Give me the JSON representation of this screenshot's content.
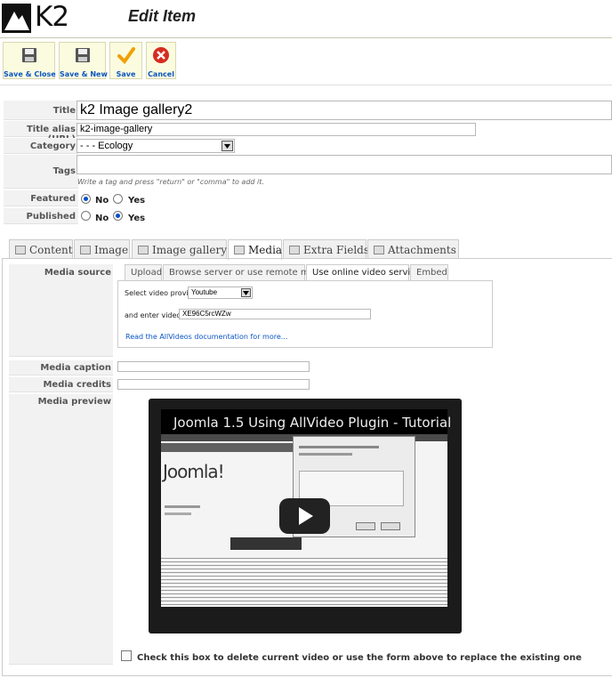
{
  "header": {
    "logo_text": "K2",
    "page_title": "Edit Item"
  },
  "toolbar": {
    "save_close": "Save & Close",
    "save_new": "Save & New",
    "save": "Save",
    "cancel": "Cancel"
  },
  "form": {
    "title_label": "Title",
    "title_value": "k2 Image gallery2",
    "alias_label": "Title alias (URL)",
    "alias_value": "k2-image-gallery",
    "category_label": "Category",
    "category_value": "- - - Ecology",
    "tags_label": "Tags",
    "tags_hint": "Write a tag and press \"return\" or \"comma\" to add it.",
    "featured_label": "Featured",
    "published_label": "Published",
    "no": "No",
    "yes": "Yes",
    "featured": "No",
    "published": "Yes"
  },
  "tabs": [
    {
      "label": "Content",
      "icon": "document-icon"
    },
    {
      "label": "Image",
      "icon": "image-icon"
    },
    {
      "label": "Image gallery",
      "icon": "gallery-icon"
    },
    {
      "label": "Media",
      "icon": "film-icon",
      "active": true
    },
    {
      "label": "Extra Fields",
      "icon": "tools-icon"
    },
    {
      "label": "Attachments",
      "icon": "paperclip-icon"
    }
  ],
  "media": {
    "source_label": "Media source",
    "subtabs": [
      "Upload",
      "Browse server or use remote media",
      "Use online video service",
      "Embed"
    ],
    "active_subtab": "Use online video service",
    "provider_label": "Select video provider",
    "provider_value": "Youtube",
    "video_id_label": "and enter video ID",
    "video_id_value": "XE96C5rcWZw",
    "docs_link": "Read the AllVideos documentation for more...",
    "caption_label": "Media caption",
    "caption_value": "",
    "credits_label": "Media credits",
    "credits_value": "",
    "preview_label": "Media preview",
    "video_title": "Joomla 1.5 Using AllVideo Plugin - Tutorial",
    "video_site_logo": "Joomla!",
    "delete_label": "Check this box to delete current video or use the form above to replace the existing one"
  },
  "colors": {
    "link": "#0b55c4",
    "save_green": "#f0a000",
    "cancel_red": "#d62b1f",
    "toolbar_bg": "#fbfbdf"
  }
}
